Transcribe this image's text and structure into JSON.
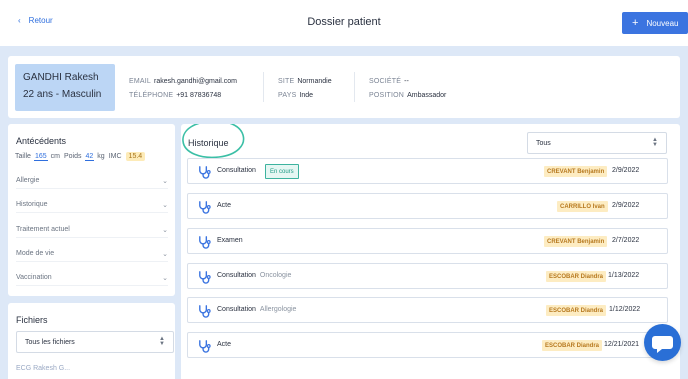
{
  "header": {
    "back_label": "Retour",
    "title": "Dossier patient",
    "new_button_label": "Nouveau"
  },
  "patient": {
    "name": "GANDHI Rakesh",
    "age_sex": "22 ans - Masculin",
    "email_label": "EMAIL",
    "email": "rakesh.gandhi@gmail.com",
    "phone_label": "TÉLÉPHONE",
    "phone": "+91 87836748",
    "site_label": "SITE",
    "site": "Normandie",
    "country_label": "PAYS",
    "country": "Inde",
    "company_label": "SOCIÉTÉ",
    "company": "--",
    "position_label": "POSITION",
    "position": "Ambassador"
  },
  "antecedents": {
    "title": "Antécédents",
    "height_label": "Taille",
    "height_value": "165",
    "height_unit": "cm",
    "weight_label": "Poids",
    "weight_value": "42",
    "weight_unit": "kg",
    "bmi_label": "IMC",
    "bmi_value": "15.4",
    "sections": [
      "Allergie",
      "Historique",
      "Traitement actuel",
      "Mode de vie",
      "Vaccination"
    ]
  },
  "files": {
    "title": "Fichiers",
    "filter_value": "Tous les fichiers",
    "first_item_peek": "ECG Rakesh G..."
  },
  "history": {
    "title": "Historique",
    "filter_value": "Tous",
    "rows": [
      {
        "type": "Consultation",
        "specialty": "",
        "status": "En cours",
        "doctor": "CREVANT Benjamin",
        "date": "2/9/2022"
      },
      {
        "type": "Acte",
        "specialty": "",
        "status": "",
        "doctor": "CARRILLO Ivan",
        "date": "2/9/2022"
      },
      {
        "type": "Examen",
        "specialty": "",
        "status": "",
        "doctor": "CREVANT Benjamin",
        "date": "2/7/2022"
      },
      {
        "type": "Consultation",
        "specialty": "Oncologie",
        "status": "",
        "doctor": "ESCOBAR Diandra",
        "date": "1/13/2022"
      },
      {
        "type": "Consultation",
        "specialty": "Allergologie",
        "status": "",
        "doctor": "ESCOBAR Diandra",
        "date": "1/12/2022"
      },
      {
        "type": "Acte",
        "specialty": "",
        "status": "",
        "doctor": "ESCOBAR Diandra",
        "date": "12/21/2021"
      }
    ]
  },
  "icons": {
    "back": "chevron-left-icon",
    "new": "plus-icon",
    "row": "stethoscope-icon",
    "accordion": "chevron-down-icon",
    "select": "select-arrows-icon",
    "chat": "chat-bubble-icon"
  },
  "colors": {
    "accent": "#3b74e0",
    "background": "#dde8f7",
    "patient_id_box": "#bcd6f5",
    "doctor_badge": "#fdecc2",
    "status_badge": "#3db39f",
    "history_highlight": "#3bbfa6"
  }
}
